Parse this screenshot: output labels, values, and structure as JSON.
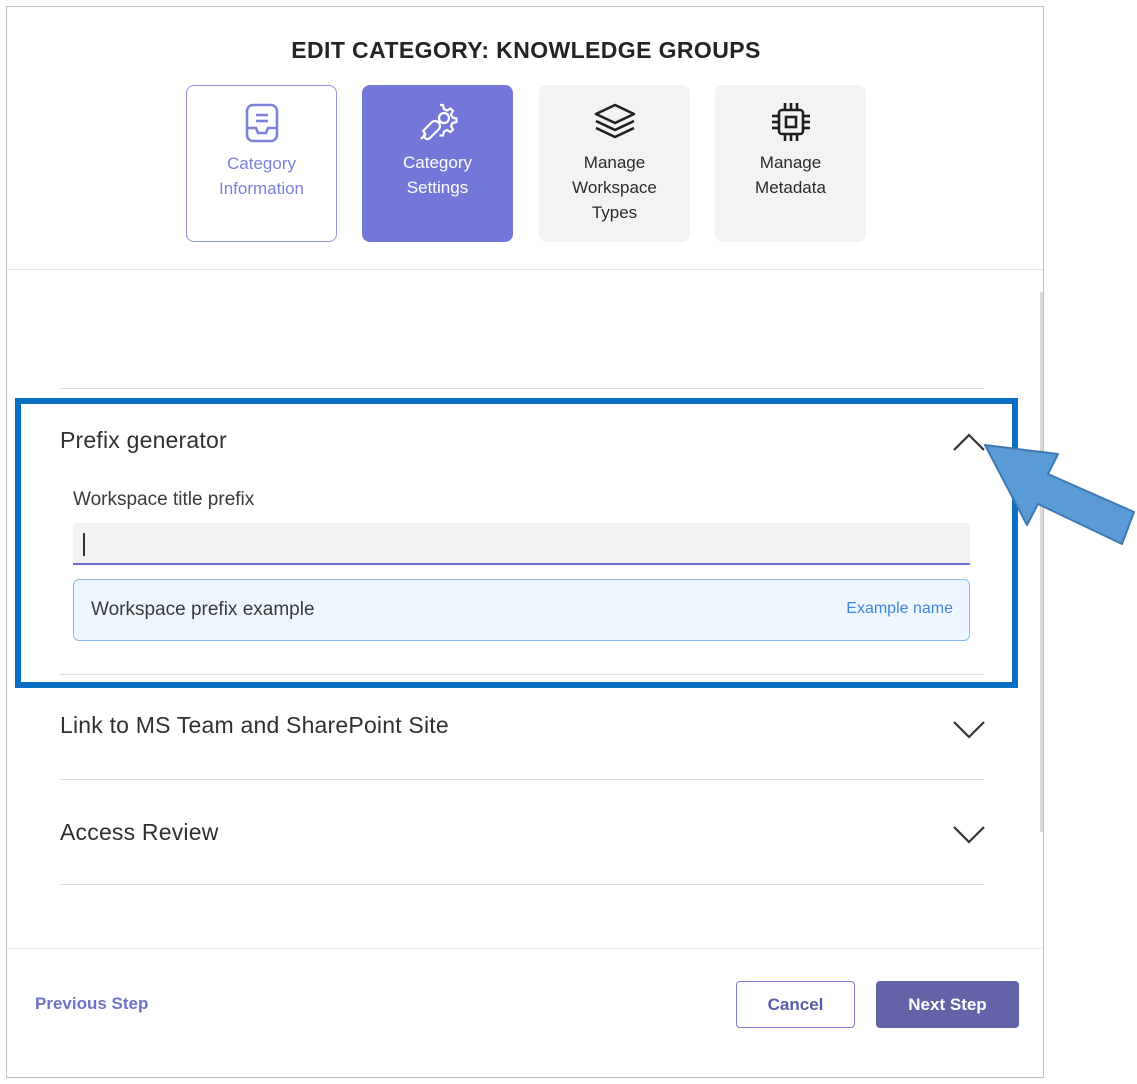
{
  "dialog": {
    "title": "EDIT CATEGORY: KNOWLEDGE GROUPS"
  },
  "steps": [
    {
      "label": "Category Information",
      "icon": "inbox-tray-icon",
      "state": "visited"
    },
    {
      "label": "Category Settings",
      "icon": "settings-wrench-icon",
      "state": "active"
    },
    {
      "label": "Manage Workspace Types",
      "icon": "layers-icon",
      "state": "pending"
    },
    {
      "label": "Manage Metadata",
      "icon": "chip-icon",
      "state": "pending"
    }
  ],
  "sections": {
    "prefix": {
      "title": "Prefix generator",
      "expanded": true,
      "field_label": "Workspace title prefix",
      "field_value": "",
      "example_label": "Workspace prefix example",
      "example_value": "Example name"
    },
    "link": {
      "title": "Link to MS Team and SharePoint Site",
      "expanded": false
    },
    "access": {
      "title": "Access Review",
      "expanded": false
    }
  },
  "footer": {
    "previous_label": "Previous Step",
    "cancel_label": "Cancel",
    "next_label": "Next Step"
  },
  "annotation": {
    "highlight_color": "#0a6fc2",
    "arrow_color": "#5b9bd5"
  },
  "colors": {
    "accent": "#6264a7",
    "active_step": "#7378d8"
  }
}
